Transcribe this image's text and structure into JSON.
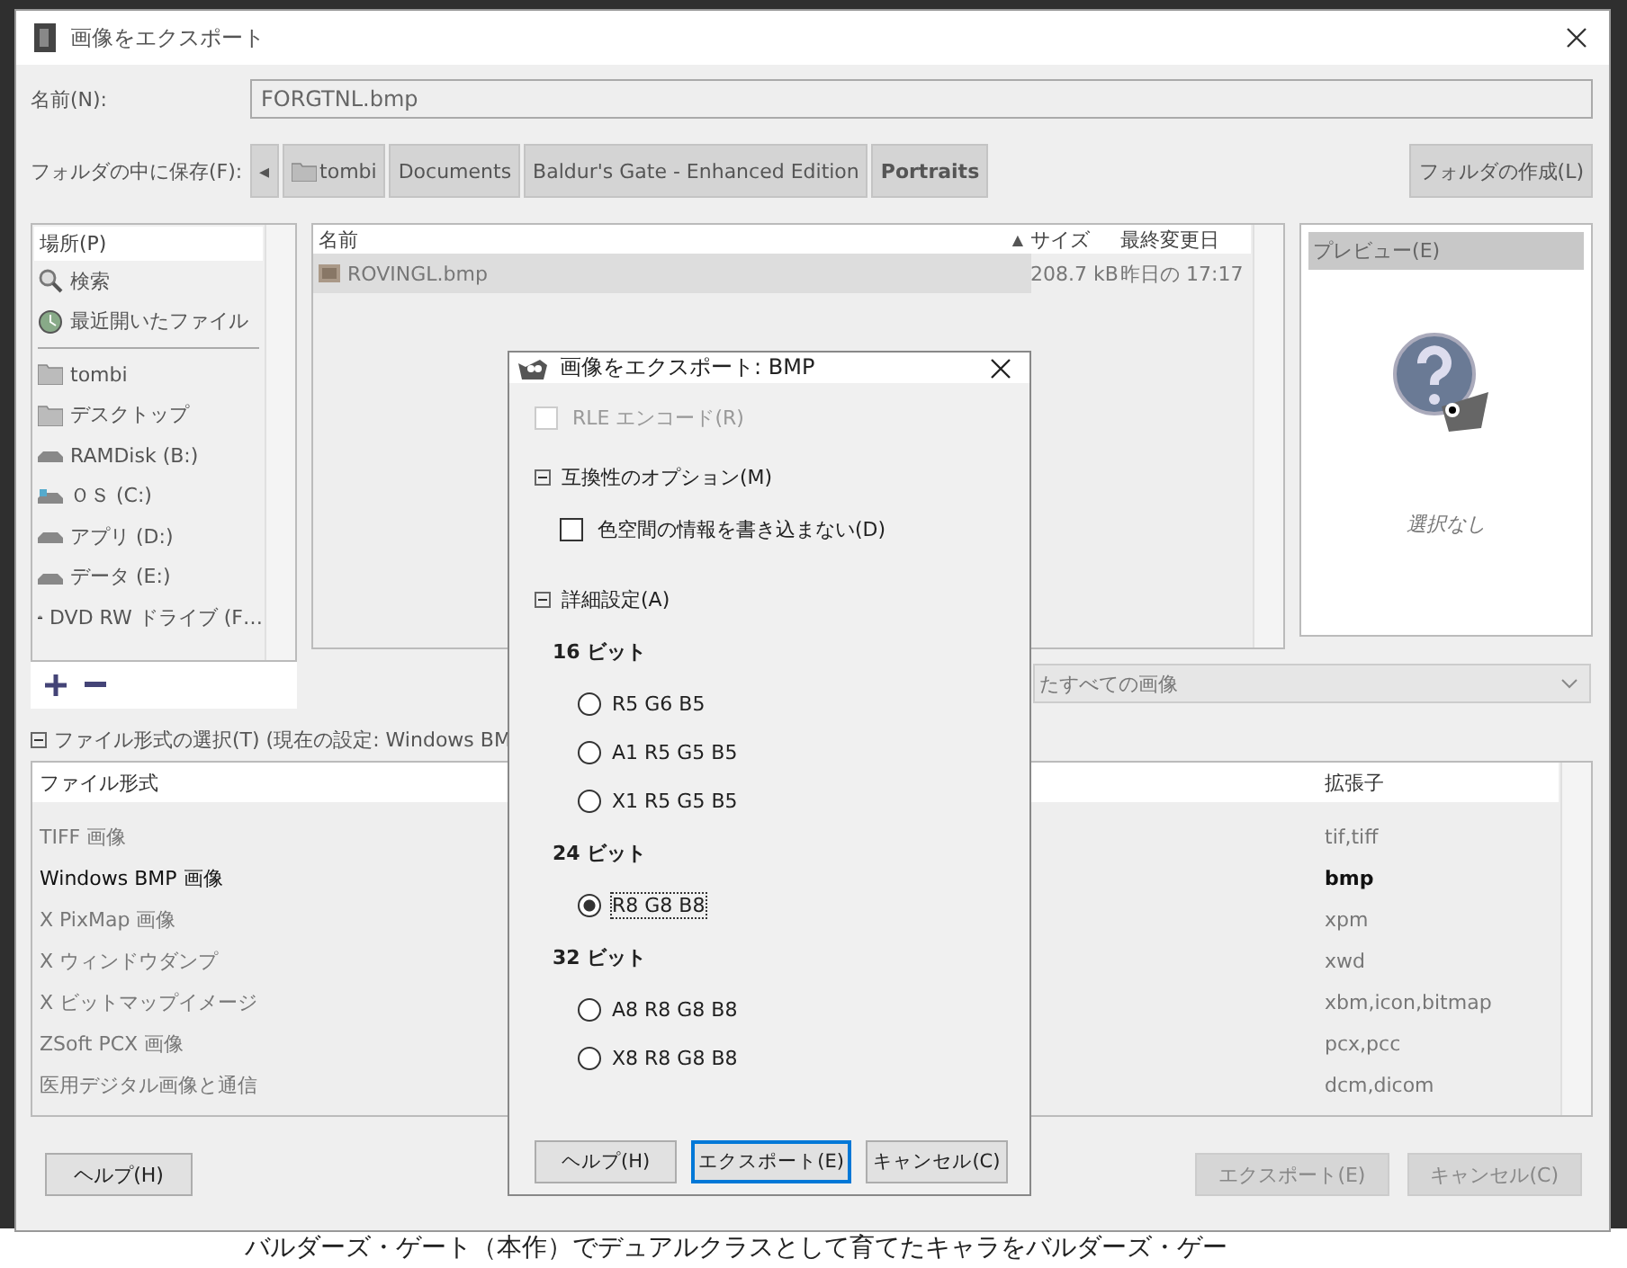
{
  "background_text": "バルダーズ・ゲート（本作）でデュアルクラスとして育てたキャラをバルダーズ・ゲー",
  "window": {
    "title": "画像をエクスポート"
  },
  "name_field": {
    "label": "名前(N):",
    "value": "FORGTNL.bmp"
  },
  "folder_row": {
    "label": "フォルダの中に保存(F):",
    "back": "◂",
    "path": [
      {
        "label": "tombi",
        "kind": "folder",
        "selected": false
      },
      {
        "label": "Documents",
        "kind": "plain",
        "selected": false
      },
      {
        "label": "Baldur's Gate - Enhanced Edition",
        "kind": "plain",
        "selected": false
      },
      {
        "label": "Portraits",
        "kind": "plain",
        "selected": true
      }
    ],
    "create_folder": "フォルダの作成(L)"
  },
  "places": {
    "header": "場所(P)",
    "items": [
      {
        "label": "検索",
        "kind": "search"
      },
      {
        "label": "最近開いたファイル",
        "kind": "recent"
      },
      {
        "kind": "separator"
      },
      {
        "label": "tombi",
        "kind": "folder"
      },
      {
        "label": "デスクトップ",
        "kind": "folder"
      },
      {
        "label": "RAMDisk (B:)",
        "kind": "drive"
      },
      {
        "label": "ＯＳ (C:)",
        "kind": "system-drive"
      },
      {
        "label": "アプリ (D:)",
        "kind": "drive"
      },
      {
        "label": "データ (E:)",
        "kind": "drive"
      },
      {
        "label": "DVD RW ドライブ (F…",
        "kind": "optical"
      }
    ]
  },
  "files": {
    "columns": [
      "名前",
      "サイズ",
      "最終変更日"
    ],
    "sort_arrow": "▲",
    "rows": [
      {
        "name": "ROVINGL.bmp",
        "size": "208.7 kB",
        "modified": "昨日の 17:17",
        "selected": true
      }
    ]
  },
  "preview": {
    "header": "プレビュー(E)",
    "caption": "選択なし"
  },
  "filter": {
    "value": "たすべての画像"
  },
  "file_type": {
    "label": "ファイル形式の選択(T) (現在の設定: Windows BM",
    "expanded": true,
    "columns": [
      "ファイル形式",
      "拡張子"
    ],
    "rows": [
      {
        "name": "TIFF 画像",
        "ext": "tif,tiff",
        "selected": false
      },
      {
        "name": "Windows BMP 画像",
        "ext": "bmp",
        "selected": true
      },
      {
        "name": "X PixMap 画像",
        "ext": "xpm",
        "selected": false
      },
      {
        "name": "X ウィンドウダンプ",
        "ext": "xwd",
        "selected": false
      },
      {
        "name": "X ビットマップイメージ",
        "ext": "xbm,icon,bitmap",
        "selected": false
      },
      {
        "name": "ZSoft PCX 画像",
        "ext": "pcx,pcc",
        "selected": false
      },
      {
        "name": "医用デジタル画像と通信",
        "ext": "dcm,dicom",
        "selected": false
      }
    ]
  },
  "buttons": [
    {
      "label": "ヘルプ(H)",
      "disabled": false
    },
    {
      "label": "エクスポート(E)",
      "disabled": true
    },
    {
      "label": "キャンセル(C)",
      "disabled": true
    }
  ],
  "dialog": {
    "title": "画像をエクスポート: BMP",
    "rle": {
      "label": "RLE エンコード(R)",
      "checked": false,
      "disabled": true
    },
    "sections": [
      {
        "label": "互換性のオプション(M)",
        "expanded": true,
        "kind": "checks",
        "items": [
          {
            "label": "色空間の情報を書き込まない(D)",
            "checked": false
          }
        ]
      },
      {
        "label": "詳細設定(A)",
        "expanded": true,
        "kind": "radios",
        "groups": [
          {
            "label": "16 ビット",
            "options": [
              {
                "label": "R5 G6 B5",
                "selected": false
              },
              {
                "label": "A1 R5 G5 B5",
                "selected": false
              },
              {
                "label": "X1 R5 G5 B5",
                "selected": false
              }
            ]
          },
          {
            "label": "24 ビット",
            "options": [
              {
                "label": "R8 G8 B8",
                "selected": true
              }
            ]
          },
          {
            "label": "32 ビット",
            "options": [
              {
                "label": "A8 R8 G8 B8",
                "selected": false
              },
              {
                "label": "X8 R8 G8 B8",
                "selected": false
              }
            ]
          }
        ]
      }
    ],
    "buttons": [
      {
        "label": "ヘルプ(H)",
        "default": false
      },
      {
        "label": "エクスポート(E)",
        "default": true
      },
      {
        "label": "キャンセル(C)",
        "default": false
      }
    ]
  }
}
